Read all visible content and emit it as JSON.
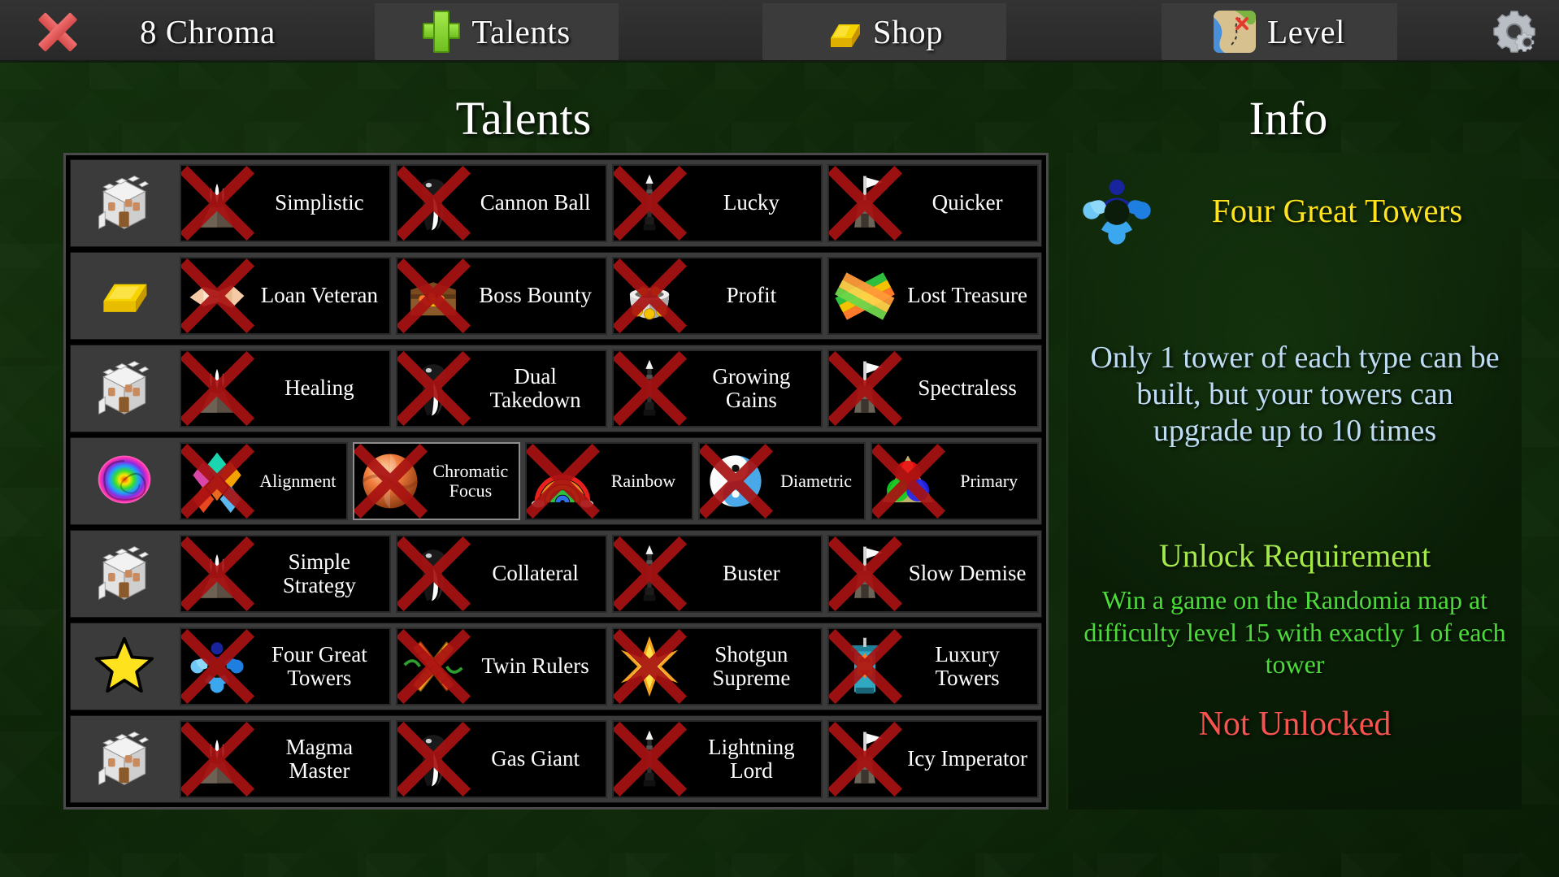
{
  "topbar": {
    "close_label": "",
    "chroma_label": "8 Chroma",
    "talents_label": "Talents",
    "shop_label": "Shop",
    "level_label": "Level",
    "settings_label": "",
    "icons": {
      "close": "close-x-icon",
      "chroma": "chroma-icon",
      "talents": "green-plus-icon",
      "shop": "gold-bar-icon",
      "level": "treasure-map-icon",
      "settings": "gear-icon"
    }
  },
  "headings": {
    "talents": "Talents",
    "info": "Info"
  },
  "grid": {
    "rows": [
      {
        "category_icon": "castle-icon",
        "cells": [
          {
            "label": "Simplistic",
            "icon": "volcano-icon",
            "locked": true,
            "selected": false
          },
          {
            "label": "Cannon Ball",
            "icon": "cannonball-icon",
            "locked": true,
            "selected": false
          },
          {
            "label": "Lucky",
            "icon": "dart-icon",
            "locked": true,
            "selected": false
          },
          {
            "label": "Quicker",
            "icon": "flag-tower-icon",
            "locked": true,
            "selected": false
          }
        ]
      },
      {
        "category_icon": "gold-bar-icon",
        "cells": [
          {
            "label": "Loan Veteran",
            "icon": "handshake-icon",
            "locked": true,
            "selected": false
          },
          {
            "label": "Boss Bounty",
            "icon": "treasure-box-icon",
            "locked": true,
            "selected": false
          },
          {
            "label": "Profit",
            "icon": "coin-pot-icon",
            "locked": true,
            "selected": false
          },
          {
            "label": "Lost Treasure",
            "icon": "ribbon-icon",
            "locked": false,
            "selected": false
          }
        ]
      },
      {
        "category_icon": "castle-icon",
        "cells": [
          {
            "label": "Healing",
            "icon": "volcano-icon",
            "locked": true,
            "selected": false
          },
          {
            "label": "Dual Takedown",
            "icon": "cannonball-icon",
            "locked": true,
            "selected": false
          },
          {
            "label": "Growing Gains",
            "icon": "dart-icon",
            "locked": true,
            "selected": false
          },
          {
            "label": "Spectraless",
            "icon": "flag-tower-icon",
            "locked": true,
            "selected": false
          }
        ]
      },
      {
        "category_icon": "rainbow-spiral-icon",
        "cells": [
          {
            "label": "Alignment",
            "icon": "diamond-cluster-icon",
            "locked": true,
            "selected": false,
            "small": true
          },
          {
            "label": "Chromatic Focus",
            "icon": "orange-sphere-icon",
            "locked": true,
            "selected": true,
            "small": true
          },
          {
            "label": "Rainbow",
            "icon": "rainbow-icon",
            "locked": true,
            "selected": false,
            "small": true
          },
          {
            "label": "Diametric",
            "icon": "yin-yang-icon",
            "locked": true,
            "selected": false,
            "small": true
          },
          {
            "label": "Primary",
            "icon": "rgb-circles-icon",
            "locked": true,
            "selected": false,
            "small": true
          }
        ]
      },
      {
        "category_icon": "castle-icon",
        "cells": [
          {
            "label": "Simple Strategy",
            "icon": "volcano-icon",
            "locked": true,
            "selected": false
          },
          {
            "label": "Collateral",
            "icon": "cannonball-icon",
            "locked": true,
            "selected": false
          },
          {
            "label": "Buster",
            "icon": "dart-icon",
            "locked": true,
            "selected": false
          },
          {
            "label": "Slow Demise",
            "icon": "flag-tower-icon",
            "locked": true,
            "selected": false
          }
        ]
      },
      {
        "category_icon": "star-icon",
        "cells": [
          {
            "label": "Four Great Towers",
            "icon": "four-towers-icon",
            "locked": true,
            "selected": false
          },
          {
            "label": "Twin Rulers",
            "icon": "twin-rulers-icon",
            "locked": true,
            "selected": false
          },
          {
            "label": "Shotgun Supreme",
            "icon": "star-burst-icon",
            "locked": true,
            "selected": false
          },
          {
            "label": "Luxury Towers",
            "icon": "luxury-tower-icon",
            "locked": true,
            "selected": false
          }
        ]
      },
      {
        "category_icon": "castle-icon",
        "cells": [
          {
            "label": "Magma Master",
            "icon": "volcano-icon",
            "locked": true,
            "selected": false
          },
          {
            "label": "Gas Giant",
            "icon": "cannonball-icon",
            "locked": true,
            "selected": false
          },
          {
            "label": "Lightning Lord",
            "icon": "dart-icon",
            "locked": true,
            "selected": false
          },
          {
            "label": "Icy Imperator",
            "icon": "flag-tower-icon",
            "locked": true,
            "selected": false
          }
        ]
      }
    ]
  },
  "info": {
    "talent_name": "Four Great Towers",
    "talent_icon": "four-towers-icon",
    "description": "Only 1 tower of each type can be built, but your towers can upgrade up to 10 times",
    "unlock_title": "Unlock Requirement",
    "unlock_desc": "Win a game on the Randomia map at difficulty level 15 with exactly 1 of each tower",
    "status": "Not Unlocked"
  },
  "colors": {
    "talent_name": "#ffe31e",
    "description": "#bedcf4",
    "unlock_title": "#a4e84a",
    "unlock_desc": "#4ddb3c",
    "status_locked": "#f8534f",
    "topbar_bg": "#2e2e2e",
    "cell_bg": "#000000",
    "row_bg": "#3b3b3b"
  }
}
